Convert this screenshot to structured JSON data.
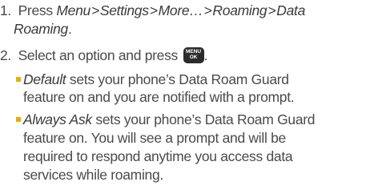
{
  "steps": [
    {
      "number": "1.",
      "text": "Press",
      "menu_path": [
        "Menu",
        "Settings",
        "More…",
        "Roaming",
        "Data Roaming"
      ],
      "separator": ">",
      "period": "."
    },
    {
      "number": "2.",
      "text": "Select an option and press",
      "key_icon": {
        "name": "menu-ok-key-icon",
        "line1": "MENU",
        "line2": "OK"
      },
      "period": "."
    }
  ],
  "options": [
    {
      "term": "Default",
      "lines": [
        "sets your phone’s Data Roam Guard",
        "feature on and you are notified with a prompt."
      ]
    },
    {
      "term": "Always Ask",
      "lines": [
        "sets your phone’s Data Roam Guard",
        "feature on. You will see a prompt and will be",
        "required to respond anytime you access data",
        "services while roaming."
      ]
    }
  ],
  "colors": {
    "text": "#4a4a4a",
    "bullet": "#f2a900",
    "key_icon_bg": "#2b2b2b"
  }
}
